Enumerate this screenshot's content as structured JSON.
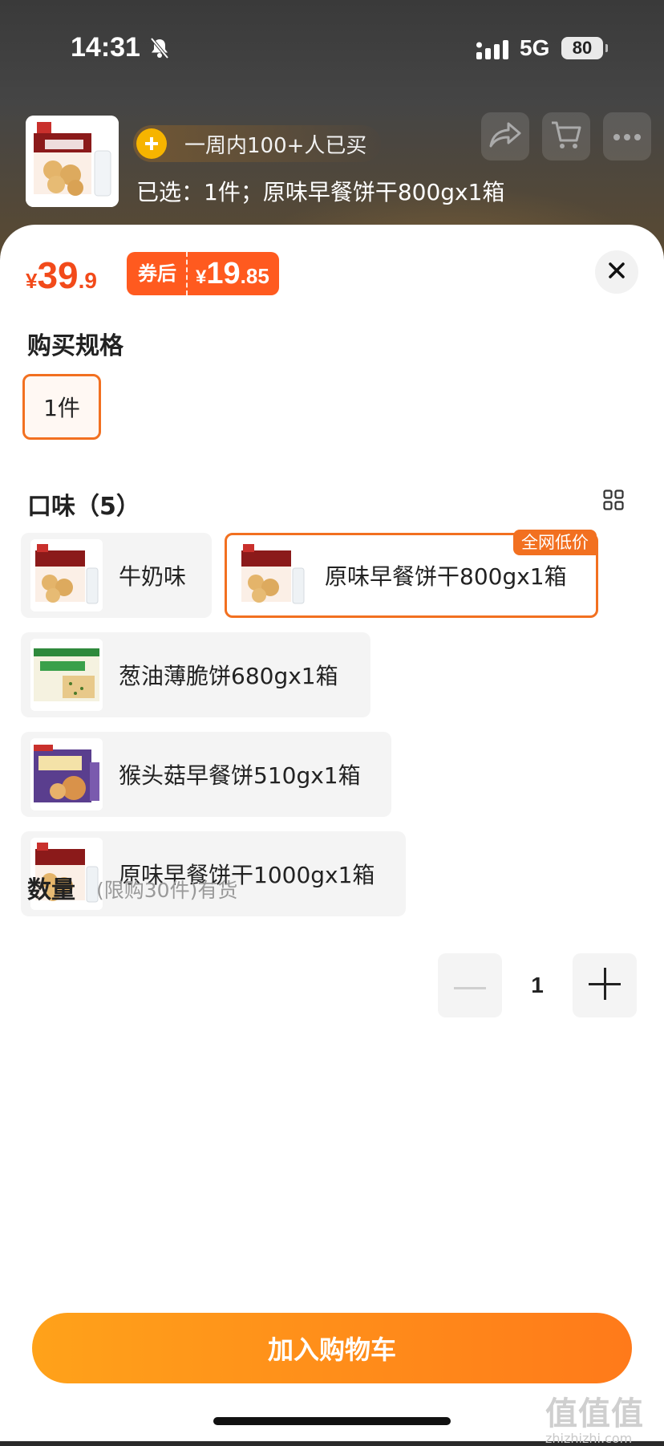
{
  "status_bar": {
    "time": "14:31",
    "network": "5G",
    "battery": "80"
  },
  "summary": {
    "buyers_text": "一周内100+人已买",
    "selected_text": "已选：1件；原味早餐饼干800gx1箱"
  },
  "price": {
    "currency": "¥",
    "original_int": "39",
    "original_dec": ".9",
    "coupon_tag": "券后",
    "after_int": "19",
    "after_dec": ".85"
  },
  "spec": {
    "title": "购买规格",
    "options": [
      "1件"
    ]
  },
  "flavor": {
    "title": "口味（5）",
    "badge": "全网低价",
    "options": [
      {
        "label": "牛奶味",
        "thumb_icon": "biscuit-box-icon"
      },
      {
        "label": "原味早餐饼干800gx1箱",
        "thumb_icon": "biscuit-box-icon",
        "selected": true
      },
      {
        "label": "葱油薄脆饼680gx1箱",
        "thumb_icon": "scallion-cracker-box-icon"
      },
      {
        "label": "猴头菇早餐饼510gx1箱",
        "thumb_icon": "mushroom-biscuit-box-icon"
      },
      {
        "label": "原味早餐饼干1000gx1箱",
        "thumb_icon": "biscuit-box-icon"
      }
    ]
  },
  "quantity": {
    "label": "数量",
    "note": "(限购30件)有货",
    "value": "1"
  },
  "cta": {
    "add_to_cart": "加入购物车"
  },
  "watermark": {
    "main": "值值值",
    "sub": "zhizhizhi.com"
  },
  "colors": {
    "accent": "#f27020",
    "price": "#f24a1a",
    "cta_start": "#ffa21a",
    "cta_end": "#ff7a1a"
  }
}
